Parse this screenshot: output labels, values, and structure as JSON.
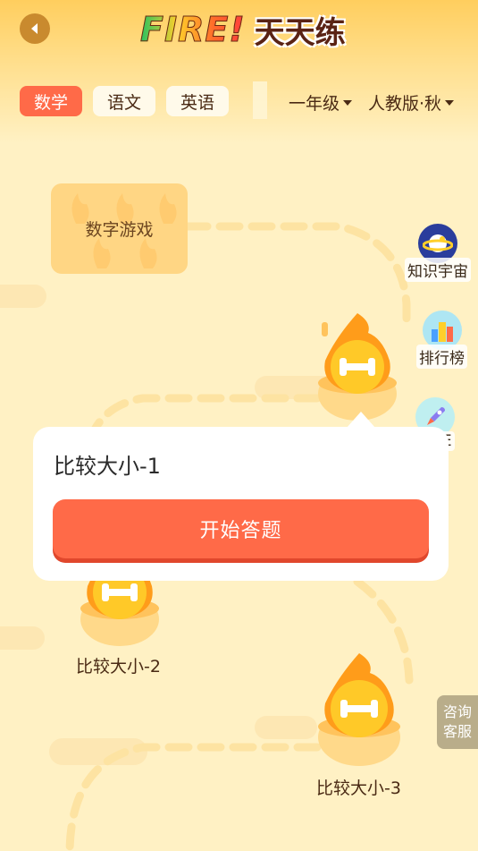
{
  "header": {
    "logo_fire": "FIRE!",
    "logo_cn": "天天练"
  },
  "tabs": [
    {
      "label": "数学",
      "active": true
    },
    {
      "label": "语文",
      "active": false
    },
    {
      "label": "英语",
      "active": false
    }
  ],
  "filters": {
    "grade": "一年级",
    "edition": "人教版·秋"
  },
  "game_card": {
    "label": "数字游戏"
  },
  "side_buttons": [
    {
      "label": "知识宇宙",
      "icon": "planet-icon"
    },
    {
      "label": "排行榜",
      "icon": "leaderboard-icon"
    },
    {
      "label": "FIRE",
      "icon": "rocket-icon"
    }
  ],
  "popup": {
    "title": "比较大小-1",
    "start_button": "开始答题"
  },
  "nodes": [
    {
      "label": "比较大小-2"
    },
    {
      "label": "比较大小-3"
    }
  ],
  "consult": {
    "line1": "咨询",
    "line2": "客服"
  },
  "colors": {
    "accent": "#ff6a48",
    "background": "#fff1c4",
    "flame": "#ffb020"
  }
}
